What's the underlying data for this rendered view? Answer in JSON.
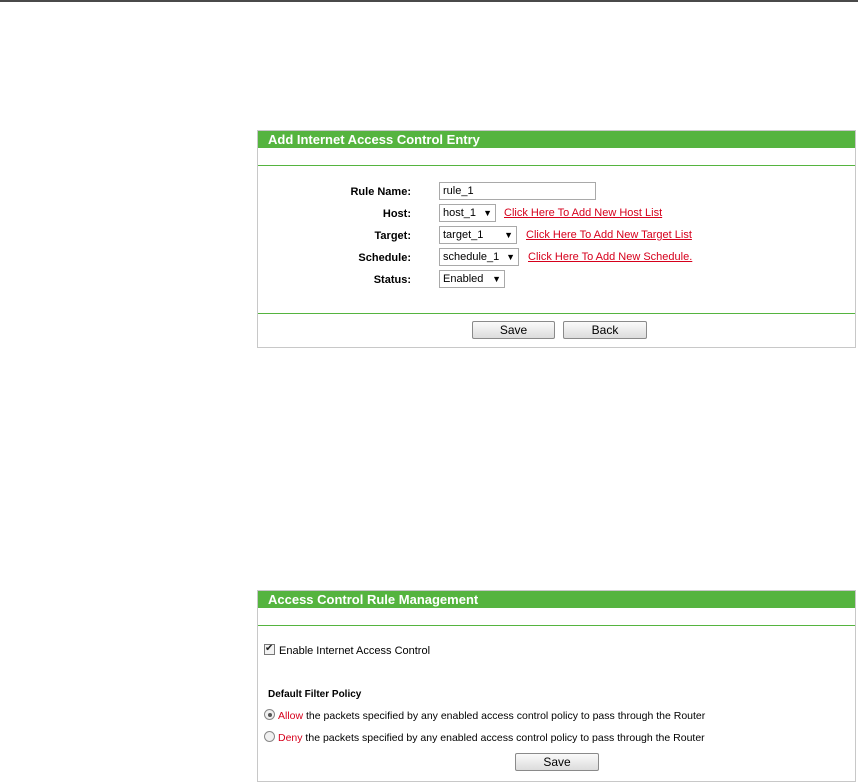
{
  "add_entry": {
    "title": "Add Internet Access Control Entry",
    "rule_name_label": "Rule Name:",
    "rule_name_value": "rule_1",
    "host_label": "Host:",
    "host_value": "host_1",
    "host_link": "Click Here To Add New Host List",
    "target_label": "Target:",
    "target_value": "target_1",
    "target_link": "Click Here To Add New Target List",
    "schedule_label": "Schedule:",
    "schedule_value": "schedule_1",
    "schedule_link": "Click Here To Add New Schedule.",
    "status_label": "Status:",
    "status_value": "Enabled",
    "save_label": "Save",
    "back_label": "Back"
  },
  "rule_mgmt": {
    "title": "Access Control Rule Management",
    "enable_label": "Enable Internet Access Control",
    "enable_checked": true,
    "policy_heading": "Default Filter Policy",
    "allow_word": "Allow",
    "allow_rest": " the packets specified by any enabled access control policy to pass through the Router",
    "deny_word": "Deny",
    "deny_rest": " the packets specified by any enabled access control policy to pass through the Router",
    "selected_policy": "Allow",
    "save_label": "Save"
  },
  "colors": {
    "header_green": "#55b43f",
    "link_red": "#d6001c"
  },
  "icons": {
    "dropdown": "dropdown-arrow-icon",
    "check": "checkmark-icon"
  }
}
